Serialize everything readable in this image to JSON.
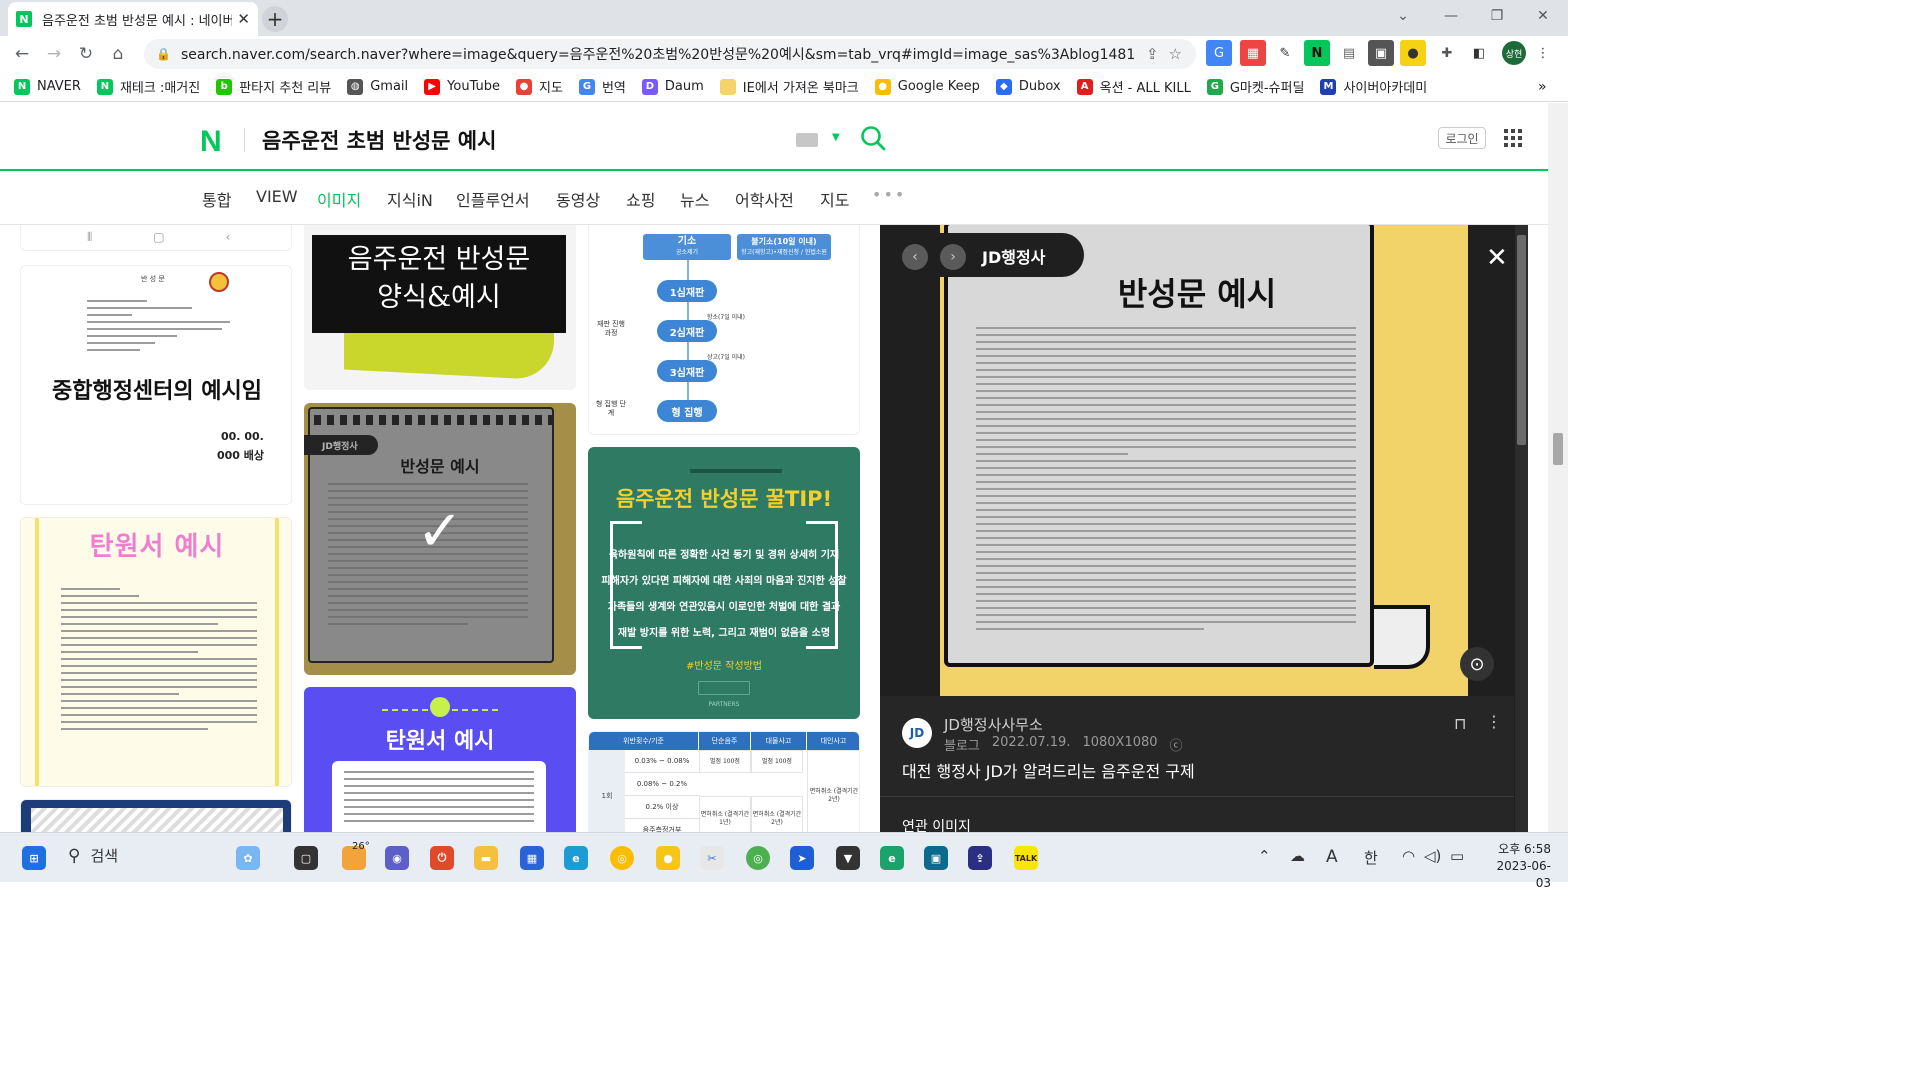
{
  "browser": {
    "tab_title": "음주운전 초범 반성문 예시 : 네이버",
    "favicon_letter": "N",
    "new_tab": "+",
    "url": "search.naver.com/search.naver?where=image&query=음주운전%20초범%20반성문%20예시&sm=tab_vrq#imgId=image_sas%3Ablog148144098...",
    "profile_label": "상현"
  },
  "bookmarks": [
    {
      "label": "NAVER",
      "color": "#03c75a",
      "glyph": "N"
    },
    {
      "label": "재테크 :매거진",
      "color": "#03c75a",
      "glyph": "N"
    },
    {
      "label": "판타지 추천 리뷰",
      "color": "#1ec800",
      "glyph": "b"
    },
    {
      "label": "Gmail",
      "color": "#555555",
      "glyph": "◍"
    },
    {
      "label": "YouTube",
      "color": "#ff0000",
      "glyph": "▶"
    },
    {
      "label": "지도",
      "color": "#e94235",
      "glyph": "●"
    },
    {
      "label": "번역",
      "color": "#4285f4",
      "glyph": "G"
    },
    {
      "label": "Daum",
      "color": "#7a5af8",
      "glyph": "D"
    },
    {
      "label": "IE에서 가져온 북마크",
      "color": "#f6d36b",
      "glyph": ""
    },
    {
      "label": "Google Keep",
      "color": "#fbbc04",
      "glyph": "●"
    },
    {
      "label": "Dubox",
      "color": "#2a6cf6",
      "glyph": "◆"
    },
    {
      "label": "옥션 - ALL KILL",
      "color": "#e01e1e",
      "glyph": "A"
    },
    {
      "label": "G마켓-슈퍼딜",
      "color": "#1fa94b",
      "glyph": "G"
    },
    {
      "label": "사이버아카데미",
      "color": "#1f3fb3",
      "glyph": "M"
    }
  ],
  "bookmarks_more": "»",
  "naver": {
    "logo": "N",
    "query": "음주운전 초범 반성문 예시",
    "login": "로그인",
    "tabs": [
      "통합",
      "VIEW",
      "이미지",
      "지식iN",
      "인플루언서",
      "동영상",
      "쇼핑",
      "뉴스",
      "어학사전",
      "지도"
    ],
    "active_tab": "이미지",
    "more": "•••"
  },
  "grid": {
    "card1": {
      "title": "중합행정센터의 예시임",
      "date": "00. 00.",
      "sign": "000 배상",
      "header": "반 성 문"
    },
    "card2": {
      "title": "탄원서 예시"
    },
    "card3": {
      "title_line1": "음주운전 반성문",
      "title_line2": "양식&예시"
    },
    "card4": {
      "badge": "JD행정사",
      "title": "반성문 예시",
      "check": "✓"
    },
    "card5": {
      "title": "탄원서 예시"
    },
    "flow": {
      "top_nodes": [
        "기소",
        "불기소(10일 이내)"
      ],
      "top_subs": [
        "공소제기",
        "항고(재항고)•재정신청 / 헌법소원"
      ],
      "nodes": [
        "1심재판",
        "2심재판",
        "3심재판",
        "형 집행"
      ],
      "side_labels": [
        "재판 진행 과정",
        "형 집행 단계"
      ],
      "notes": [
        "항소(7일 이내)",
        "상고(7일 이내)"
      ]
    },
    "tip": {
      "title": "음주운전 반성문 꿀TIP!",
      "items": [
        "육하원칙에 따른 정확한 사건 동기 및 경위 상세히 기재",
        "피해자가 있다면 피해자에 대한 사죄의 마음과 진지한 성찰",
        "가족들의 생계와 연관있음시 이로인한 처벌에 대한 결과",
        "재발 방지를 위한 노력, 그리고 재범이 없음을 소명"
      ],
      "hashtag": "#반성문 작성방법",
      "brand": "PARTNERS"
    },
    "table": {
      "headers": [
        "위반횟수/기준",
        "단순음주",
        "대물사고",
        "대인사고"
      ],
      "row_label": "1회",
      "bac": [
        "0.03% ~ 0.08%",
        "0.08% ~ 0.2%",
        "0.2% 이상",
        "음주측정거부"
      ],
      "cells": [
        "벌점 100점",
        "벌점 100점",
        "면허취소 (결격기간 1년)",
        "면허취소 (결격기간 2년)",
        "면허취소 (결격기간 2년)"
      ]
    }
  },
  "preview": {
    "brand": "JD행정사",
    "title": "반성문 예시",
    "nav_prev": "‹",
    "nav_next": "›",
    "close": "✕",
    "lens": "⊙",
    "source_name": "JD행정사사무소",
    "source_type": "블로그",
    "date": "2022.07.19.",
    "size": "1080X1080",
    "cc": "ⓒ",
    "caption": "대전 행정사 JD가 알려드리는 음주운전 구제",
    "related": "연관 이미지",
    "avatar": "JD"
  },
  "taskbar": {
    "search_placeholder": "검색",
    "weather": "26°",
    "time": "오후 6:58",
    "date": "2023-06-03",
    "ime": "한",
    "ime2": "A"
  }
}
